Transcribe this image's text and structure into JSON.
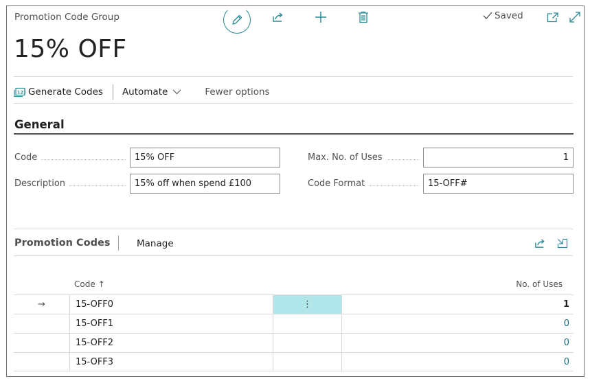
{
  "header": {
    "caption": "Promotion Code Group",
    "title": "15% OFF",
    "saved_label": "Saved"
  },
  "actions": {
    "generate_codes": "Generate Codes",
    "automate": "Automate",
    "fewer_options": "Fewer options"
  },
  "general": {
    "title": "General",
    "fields": {
      "code_label": "Code",
      "code_value": "15% OFF",
      "description_label": "Description",
      "description_value": "15% off when spend £100",
      "max_uses_label": "Max. No. of Uses",
      "max_uses_value": "1",
      "code_format_label": "Code Format",
      "code_format_value": "15-OFF#"
    }
  },
  "promotion_codes": {
    "title": "Promotion Codes",
    "manage": "Manage",
    "columns": {
      "code": "Code",
      "code_sort": "↑",
      "uses": "No. of Uses"
    },
    "rows": [
      {
        "arrow": "→",
        "code": "15-OFF0",
        "menu": "⋮",
        "uses": "1"
      },
      {
        "arrow": "",
        "code": "15-OFF1",
        "menu": "",
        "uses": "0"
      },
      {
        "arrow": "",
        "code": "15-OFF2",
        "menu": "",
        "uses": "0"
      },
      {
        "arrow": "",
        "code": "15-OFF3",
        "menu": "",
        "uses": "0"
      }
    ]
  },
  "colors": {
    "accent": "#2a8a94",
    "selected_cell": "#b1e6ea",
    "link": "#0f6b83"
  },
  "icons": [
    "edit-icon",
    "share-icon",
    "plus-icon",
    "delete-icon",
    "check-icon",
    "open-new-window-icon",
    "expand-icon",
    "generate-codes-icon",
    "chevron-down-icon",
    "arrow-right-icon",
    "more-vertical-icon",
    "collapse-icon"
  ]
}
